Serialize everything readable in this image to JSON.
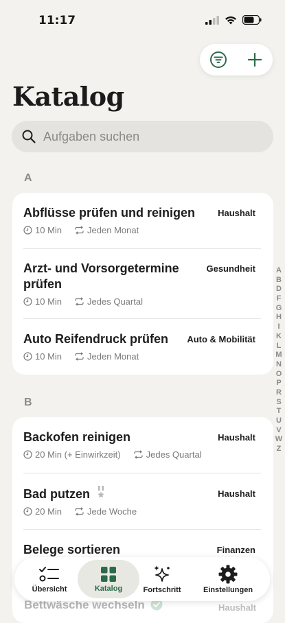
{
  "status": {
    "time": "11:17"
  },
  "header": {
    "title": "Katalog"
  },
  "search": {
    "placeholder": "Aufgaben suchen"
  },
  "sections": [
    {
      "letter": "A",
      "items": [
        {
          "name": "Abflüsse prüfen und reinigen",
          "tag": "Haushalt",
          "duration": "10 Min",
          "repeat": "Jeden Monat"
        },
        {
          "name_line1": "Arzt- und Vorsorgetermine",
          "name_line2": "prüfen",
          "tag": "Gesundheit",
          "duration": "10 Min",
          "repeat": "Jedes Quartal"
        },
        {
          "name": "Auto Reifendruck prüfen",
          "tag": "Auto & Mobilität",
          "duration": "10 Min",
          "repeat": "Jeden Monat"
        }
      ]
    },
    {
      "letter": "B",
      "items": [
        {
          "name": "Backofen reinigen",
          "tag": "Haushalt",
          "duration": "20 Min (+ Einwirkzeit)",
          "repeat": "Jedes Quartal"
        },
        {
          "name": "Bad putzen",
          "tag": "Haushalt",
          "duration": "20 Min",
          "repeat": "Jede Woche"
        },
        {
          "name": "Belege sortieren",
          "tag": "Finanzen"
        },
        {
          "name": "Bettwäsche wechseln",
          "tag": "Haushalt"
        }
      ]
    }
  ],
  "index_letters": [
    "A",
    "B",
    "D",
    "F",
    "G",
    "H",
    "I",
    "K",
    "L",
    "M",
    "N",
    "O",
    "P",
    "R",
    "S",
    "T",
    "U",
    "V",
    "W",
    "Z"
  ],
  "tabs": [
    {
      "label": "Übersicht"
    },
    {
      "label": "Katalog"
    },
    {
      "label": "Fortschritt"
    },
    {
      "label": "Einstellungen"
    }
  ],
  "colors": {
    "accent": "#2c6a4a",
    "background": "#f3f2ee"
  }
}
